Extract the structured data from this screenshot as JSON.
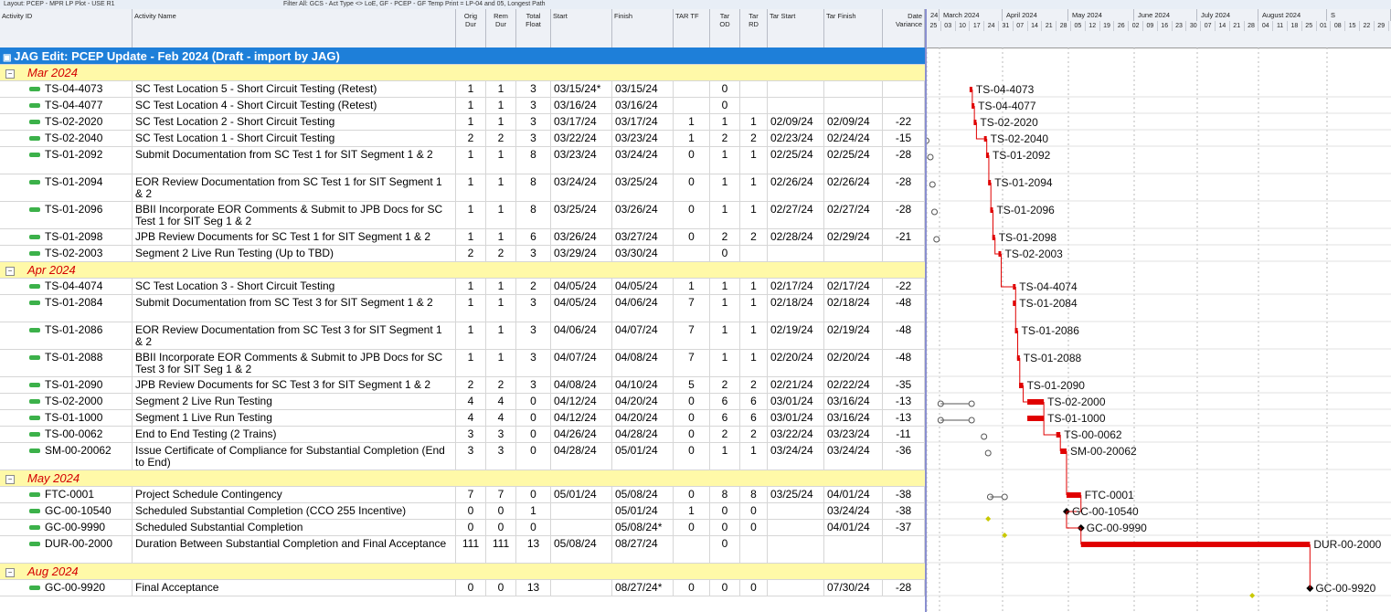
{
  "toolbar": {
    "layout": "Layout: PCEP - MPR LP Plot - USE R1",
    "filter": "Filter All: GCS - Act Type <> LoE, GF - PCEP - GF Temp Print = LP-04 and 05, Longest Path"
  },
  "columns": {
    "activity_id": "Activity ID",
    "activity_name": "Activity Name",
    "orig_dur": [
      "Orig",
      "Dur"
    ],
    "rem_dur": [
      "Rem",
      "Dur"
    ],
    "total_float": [
      "Total",
      "Float"
    ],
    "start": "Start",
    "finish": "Finish",
    "tar_tf": "TAR TF",
    "tar_od": [
      "Tar",
      "OD"
    ],
    "tar_rd": [
      "Tar",
      "RD"
    ],
    "tar_start": "Tar Start",
    "tar_finish": "Tar Finish",
    "date_variance": [
      "Date",
      "Variance"
    ]
  },
  "timeline": {
    "months": [
      "24",
      "March 2024",
      "April 2024",
      "May 2024",
      "June 2024",
      "July 2024",
      "August 2024",
      "S"
    ],
    "weeks": [
      "25",
      "03",
      "10",
      "17",
      "24",
      "31",
      "07",
      "14",
      "21",
      "28",
      "05",
      "12",
      "19",
      "26",
      "02",
      "09",
      "16",
      "23",
      "30",
      "07",
      "14",
      "21",
      "28",
      "04",
      "11",
      "18",
      "25",
      "01",
      "08",
      "15",
      "22",
      "29"
    ]
  },
  "project": {
    "title": "JAG Edit: PCEP Update - Feb 2024 (Draft - import by JAG)"
  },
  "groups": [
    {
      "month": "Mar 2024",
      "rows": [
        {
          "id": "TS-04-4073",
          "name": "SC Test Location 5 - Short Circuit Testing (Retest)",
          "od": "1",
          "rd": "1",
          "tf": "3",
          "start": "03/15/24*",
          "finish": "03/15/24",
          "tartf": "",
          "tod": "0",
          "trd": "",
          "tstart": "",
          "tfinish": "",
          "dv": ""
        },
        {
          "id": "TS-04-4077",
          "name": "SC Test Location 4 - Short Circuit Testing (Retest)",
          "od": "1",
          "rd": "1",
          "tf": "3",
          "start": "03/16/24",
          "finish": "03/16/24",
          "tartf": "",
          "tod": "0",
          "trd": "",
          "tstart": "",
          "tfinish": "",
          "dv": ""
        },
        {
          "id": "TS-02-2020",
          "name": "SC Test Location 2 - Short Circuit Testing",
          "od": "1",
          "rd": "1",
          "tf": "3",
          "start": "03/17/24",
          "finish": "03/17/24",
          "tartf": "1",
          "tod": "1",
          "trd": "1",
          "tstart": "02/09/24",
          "tfinish": "02/09/24",
          "dv": "-22"
        },
        {
          "id": "TS-02-2040",
          "name": "SC Test Location 1 - Short Circuit Testing",
          "od": "2",
          "rd": "2",
          "tf": "3",
          "start": "03/22/24",
          "finish": "03/23/24",
          "tartf": "1",
          "tod": "2",
          "trd": "2",
          "tstart": "02/23/24",
          "tfinish": "02/24/24",
          "dv": "-15"
        },
        {
          "id": "TS-01-2092",
          "name": "Submit Documentation from SC Test 1 for SIT Segment 1 & 2",
          "od": "1",
          "rd": "1",
          "tf": "8",
          "start": "03/23/24",
          "finish": "03/24/24",
          "tartf": "0",
          "tod": "1",
          "trd": "1",
          "tstart": "02/25/24",
          "tfinish": "02/25/24",
          "dv": "-28"
        },
        {
          "id": "TS-01-2094",
          "name": "EOR Review Documentation from SC Test 1 for SIT Segment 1 & 2",
          "od": "1",
          "rd": "1",
          "tf": "8",
          "start": "03/24/24",
          "finish": "03/25/24",
          "tartf": "0",
          "tod": "1",
          "trd": "1",
          "tstart": "02/26/24",
          "tfinish": "02/26/24",
          "dv": "-28"
        },
        {
          "id": "TS-01-2096",
          "name": "BBII Incorporate EOR Comments & Submit to JPB Docs for SC Test 1 for SIT Seg 1 & 2",
          "od": "1",
          "rd": "1",
          "tf": "8",
          "start": "03/25/24",
          "finish": "03/26/24",
          "tartf": "0",
          "tod": "1",
          "trd": "1",
          "tstart": "02/27/24",
          "tfinish": "02/27/24",
          "dv": "-28"
        },
        {
          "id": "TS-01-2098",
          "name": "JPB Review Documents for SC Test 1 for SIT Segment 1 & 2",
          "od": "1",
          "rd": "1",
          "tf": "6",
          "start": "03/26/24",
          "finish": "03/27/24",
          "tartf": "0",
          "tod": "2",
          "trd": "2",
          "tstart": "02/28/24",
          "tfinish": "02/29/24",
          "dv": "-21"
        },
        {
          "id": "TS-02-2003",
          "name": "Segment 2 Live Run Testing (Up to TBD)",
          "od": "2",
          "rd": "2",
          "tf": "3",
          "start": "03/29/24",
          "finish": "03/30/24",
          "tartf": "",
          "tod": "0",
          "trd": "",
          "tstart": "",
          "tfinish": "",
          "dv": ""
        }
      ]
    },
    {
      "month": "Apr 2024",
      "rows": [
        {
          "id": "TS-04-4074",
          "name": "SC Test Location 3 - Short Circuit Testing",
          "od": "1",
          "rd": "1",
          "tf": "2",
          "start": "04/05/24",
          "finish": "04/05/24",
          "tartf": "1",
          "tod": "1",
          "trd": "1",
          "tstart": "02/17/24",
          "tfinish": "02/17/24",
          "dv": "-22"
        },
        {
          "id": "TS-01-2084",
          "name": "Submit Documentation from SC Test 3 for SIT Segment 1 & 2",
          "od": "1",
          "rd": "1",
          "tf": "3",
          "start": "04/05/24",
          "finish": "04/06/24",
          "tartf": "7",
          "tod": "1",
          "trd": "1",
          "tstart": "02/18/24",
          "tfinish": "02/18/24",
          "dv": "-48"
        },
        {
          "id": "TS-01-2086",
          "name": "EOR Review Documentation from SC Test 3 for SIT Segment 1 & 2",
          "od": "1",
          "rd": "1",
          "tf": "3",
          "start": "04/06/24",
          "finish": "04/07/24",
          "tartf": "7",
          "tod": "1",
          "trd": "1",
          "tstart": "02/19/24",
          "tfinish": "02/19/24",
          "dv": "-48"
        },
        {
          "id": "TS-01-2088",
          "name": "BBII Incorporate EOR Comments & Submit to JPB Docs for SC Test 3 for SIT Seg 1 & 2",
          "od": "1",
          "rd": "1",
          "tf": "3",
          "start": "04/07/24",
          "finish": "04/08/24",
          "tartf": "7",
          "tod": "1",
          "trd": "1",
          "tstart": "02/20/24",
          "tfinish": "02/20/24",
          "dv": "-48"
        },
        {
          "id": "TS-01-2090",
          "name": "JPB Review Documents for SC Test 3 for SIT Segment 1 & 2",
          "od": "2",
          "rd": "2",
          "tf": "3",
          "start": "04/08/24",
          "finish": "04/10/24",
          "tartf": "5",
          "tod": "2",
          "trd": "2",
          "tstart": "02/21/24",
          "tfinish": "02/22/24",
          "dv": "-35"
        },
        {
          "id": "TS-02-2000",
          "name": "Segment 2 Live Run Testing",
          "od": "4",
          "rd": "4",
          "tf": "0",
          "start": "04/12/24",
          "finish": "04/20/24",
          "tartf": "0",
          "tod": "6",
          "trd": "6",
          "tstart": "03/01/24",
          "tfinish": "03/16/24",
          "dv": "-13"
        },
        {
          "id": "TS-01-1000",
          "name": "Segment 1 Live Run Testing",
          "od": "4",
          "rd": "4",
          "tf": "0",
          "start": "04/12/24",
          "finish": "04/20/24",
          "tartf": "0",
          "tod": "6",
          "trd": "6",
          "tstart": "03/01/24",
          "tfinish": "03/16/24",
          "dv": "-13"
        },
        {
          "id": "TS-00-0062",
          "name": "End to End Testing (2 Trains)",
          "od": "3",
          "rd": "3",
          "tf": "0",
          "start": "04/26/24",
          "finish": "04/28/24",
          "tartf": "0",
          "tod": "2",
          "trd": "2",
          "tstart": "03/22/24",
          "tfinish": "03/23/24",
          "dv": "-11"
        },
        {
          "id": "SM-00-20062",
          "name": "Issue Certificate of Compliance for Substantial Completion (End to End)",
          "od": "3",
          "rd": "3",
          "tf": "0",
          "start": "04/28/24",
          "finish": "05/01/24",
          "tartf": "0",
          "tod": "1",
          "trd": "1",
          "tstart": "03/24/24",
          "tfinish": "03/24/24",
          "dv": "-36"
        }
      ]
    },
    {
      "month": "May 2024",
      "rows": [
        {
          "id": "FTC-0001",
          "name": "Project Schedule Contingency",
          "od": "7",
          "rd": "7",
          "tf": "0",
          "start": "05/01/24",
          "finish": "05/08/24",
          "tartf": "0",
          "tod": "8",
          "trd": "8",
          "tstart": "03/25/24",
          "tfinish": "04/01/24",
          "dv": "-38"
        },
        {
          "id": "GC-00-10540",
          "name": "Scheduled Substantial Completion (CCO 255 Incentive)",
          "od": "0",
          "rd": "0",
          "tf": "1",
          "start": "",
          "finish": "05/01/24",
          "tartf": "1",
          "tod": "0",
          "trd": "0",
          "tstart": "",
          "tfinish": "03/24/24",
          "dv": "-38"
        },
        {
          "id": "GC-00-9990",
          "name": "Scheduled Substantial Completion",
          "od": "0",
          "rd": "0",
          "tf": "0",
          "start": "",
          "finish": "05/08/24*",
          "tartf": "0",
          "tod": "0",
          "trd": "0",
          "tstart": "",
          "tfinish": "04/01/24",
          "dv": "-37"
        },
        {
          "id": "DUR-00-2000",
          "name": "Duration Between Substantial Completion and Final Acceptance",
          "od": "111",
          "rd": "111",
          "tf": "13",
          "start": "05/08/24",
          "finish": "08/27/24",
          "tartf": "",
          "tod": "0",
          "trd": "",
          "tstart": "",
          "tfinish": "",
          "dv": ""
        }
      ]
    },
    {
      "month": "Aug 2024",
      "rows": [
        {
          "id": "GC-00-9920",
          "name": "Final Acceptance",
          "od": "0",
          "rd": "0",
          "tf": "13",
          "start": "",
          "finish": "08/27/24*",
          "tartf": "0",
          "tod": "0",
          "trd": "0",
          "tstart": "",
          "tfinish": "07/30/24",
          "dv": "-28"
        }
      ]
    }
  ],
  "gantt_labels": [
    "TS-04-4073",
    "TS-04-4077",
    "TS-02-2020",
    "TS-02-2040",
    "TS-01-2092",
    "TS-01-2094",
    "TS-01-2096",
    "TS-01-2098",
    "TS-02-2003",
    "TS-04-4074",
    "TS-01-2084",
    "TS-01-2086",
    "TS-01-2088",
    "TS-01-2090",
    "TS-02-2000",
    "TS-01-1000",
    "TS-00-0062",
    "SM-00-20062",
    "FTC-0001",
    "GC-00-10540",
    "GC-00-9990",
    "DUR-00-2000",
    "GC-00-9920"
  ],
  "colors": {
    "critical": "#e00000",
    "project_band": "#1e7fd9",
    "month_band": "#fff9a8",
    "milestone_target": "#c8c800"
  }
}
